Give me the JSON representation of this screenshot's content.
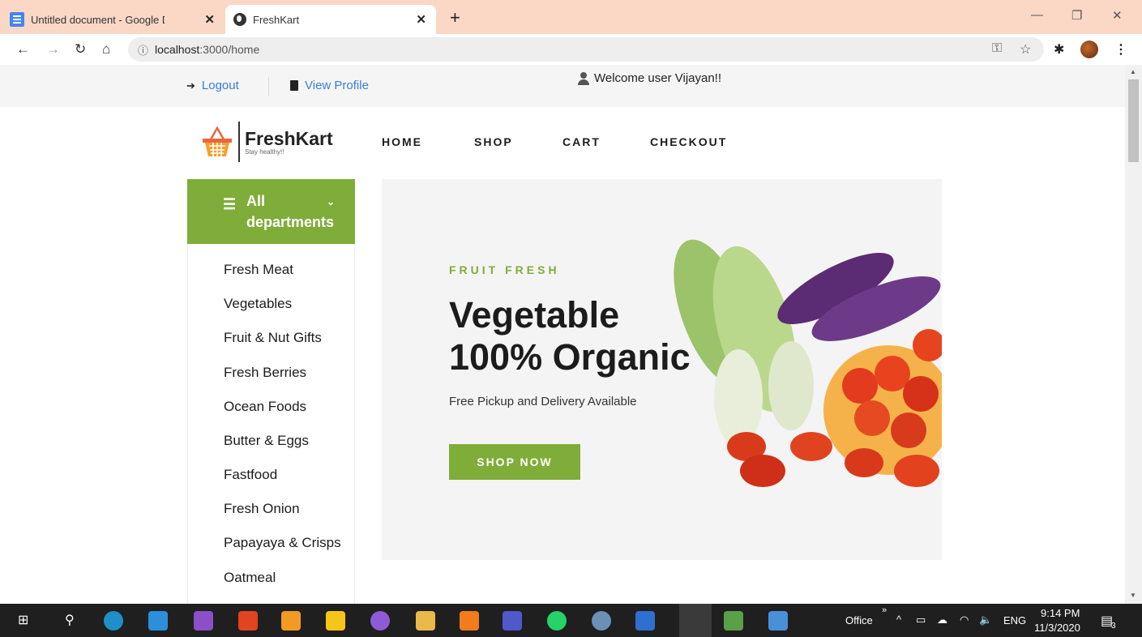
{
  "browser": {
    "tabs": [
      {
        "title": "Untitled document - Google Doc",
        "active": false
      },
      {
        "title": "FreshKart",
        "active": true
      }
    ],
    "url_host": "localhost",
    "url_rest": ":3000/home"
  },
  "topbar": {
    "logout": "Logout",
    "view_profile": "View Profile",
    "welcome": "Welcome user Vijayan!!"
  },
  "logo": {
    "name": "FreshKart",
    "tagline": "Stay healthy!!"
  },
  "nav": [
    "HOME",
    "SHOP",
    "CART",
    "CHECKOUT"
  ],
  "departments": {
    "title": "All departments",
    "items": [
      "Fresh Meat",
      "Vegetables",
      "Fruit & Nut Gifts",
      "Fresh Berries",
      "Ocean Foods",
      "Butter & Eggs",
      "Fastfood",
      "Fresh Onion",
      "Papayaya & Crisps",
      "Oatmeal"
    ]
  },
  "hero": {
    "subtitle": "FRUIT FRESH",
    "title_line1": "Vegetable",
    "title_line2": "100% Organic",
    "description": "Free Pickup and Delivery Available",
    "button": "SHOP NOW"
  },
  "taskbar": {
    "office": "Office",
    "lang": "ENG",
    "time": "9:14 PM",
    "date": "11/3/2020",
    "notifications": "3"
  },
  "colors": {
    "accent": "#7fad39",
    "tabbar": "#fbd7c6",
    "link": "#3b7dd8"
  }
}
